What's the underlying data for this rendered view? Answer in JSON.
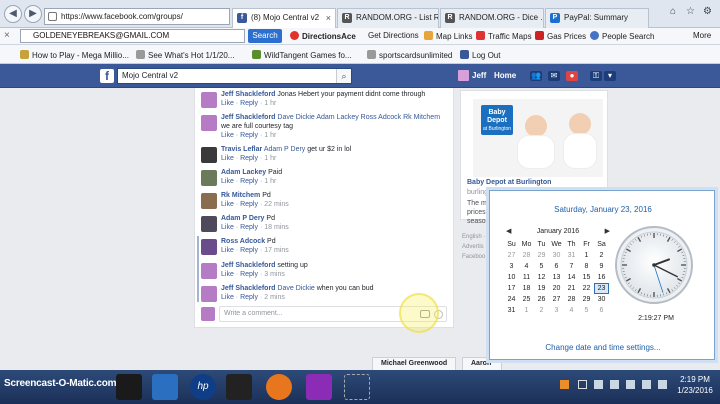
{
  "browser": {
    "address": "https://www.facebook.com/groups/",
    "tabs": [
      {
        "label": "(8) Mojo Central v2",
        "active": true
      },
      {
        "label": "RANDOM.ORG - List R...",
        "active": false
      },
      {
        "label": "RANDOM.ORG - Dice ...",
        "active": false
      },
      {
        "label": "PayPal: Summary",
        "active": false
      }
    ]
  },
  "toolbar": {
    "search_value": "GOLDENEYEBREAKS@GMAIL.COM",
    "search_button": "Search",
    "items": [
      "DirectionsAce",
      "Get Directions",
      "Map Links",
      "Traffic Maps",
      "Gas Prices",
      "People Search",
      "More"
    ]
  },
  "favorites": [
    "How to Play - Mega Millio...",
    "See What's Hot 1/1/20...",
    "WildTangent Games fo...",
    "sportscardsunlimited",
    "Log Out"
  ],
  "facebook": {
    "group_search": "Mojo Central v2",
    "user": "Jeff",
    "home": "Home"
  },
  "comments": [
    {
      "name": "Jeff Shackleford",
      "text": "Jonas Hebert your payment didnt come through",
      "tags": "",
      "time": "1 hr"
    },
    {
      "name": "Jeff Shackleford",
      "text": "we are full courtesy tag",
      "tags": "Dave Dickie Adam Lackey Ross Adcock Rk Mitchem",
      "time": "1 hr"
    },
    {
      "name": "Travis Leflar",
      "text": "get ur $2 in lol",
      "tags": "Adam P Dery",
      "time": "1 hr"
    },
    {
      "name": "Adam Lackey",
      "text": "Paid",
      "tags": "",
      "time": "1 hr"
    },
    {
      "name": "Rk Mitchem",
      "text": "Pd",
      "tags": "",
      "time": "22 mins"
    },
    {
      "name": "Adam P Dery",
      "text": "Pd",
      "tags": "",
      "time": "18 mins"
    },
    {
      "name": "Ross Adcock",
      "text": "Pd",
      "tags": "",
      "time": "17 mins"
    },
    {
      "name": "Jeff Shackleford",
      "text": "setting up",
      "tags": "",
      "time": "3 mins"
    },
    {
      "name": "Jeff Shackleford",
      "text": "when you can bud",
      "tags": "Dave Dickie",
      "time": "2 mins"
    }
  ],
  "comment_actions": {
    "like": "Like",
    "reply": "Reply",
    "sep": "·"
  },
  "write_placeholder": "Write a comment...",
  "ad": {
    "logo": "Baby Depot",
    "logo_sub": "at Burlington",
    "title": "Baby Depot at Burlington",
    "url": "burlingtoncoatfactory.com",
    "desc": "The mo prices s season"
  },
  "footer_bits": [
    "English ·",
    "Advertis",
    "Faceboo"
  ],
  "chat": [
    "Michael Greenwood",
    "Aaron"
  ],
  "clock": {
    "date_long": "Saturday, January 23, 2016",
    "month": "January 2016",
    "weekdays": [
      "Su",
      "Mo",
      "Tu",
      "We",
      "Th",
      "Fr",
      "Sa"
    ],
    "weeks": [
      [
        "27",
        "28",
        "29",
        "30",
        "31",
        "1",
        "2"
      ],
      [
        "3",
        "4",
        "5",
        "6",
        "7",
        "8",
        "9"
      ],
      [
        "10",
        "11",
        "12",
        "13",
        "14",
        "15",
        "16"
      ],
      [
        "17",
        "18",
        "19",
        "20",
        "21",
        "22",
        "23"
      ],
      [
        "24",
        "25",
        "26",
        "27",
        "28",
        "29",
        "30"
      ],
      [
        "31",
        "1",
        "2",
        "3",
        "4",
        "5",
        "6"
      ]
    ],
    "today": "23",
    "time": "2:19:27 PM",
    "hour": 2,
    "minute": 19,
    "second": 27,
    "link": "Change date and time settings..."
  },
  "taskbar": {
    "watermark": "Screencast-O-Matic.com",
    "time": "2:19 PM",
    "date": "1/23/2016"
  },
  "colors": {
    "facebook_blue": "#3b5998",
    "link_blue": "#365899",
    "clock_blue": "#1e5fa8"
  }
}
